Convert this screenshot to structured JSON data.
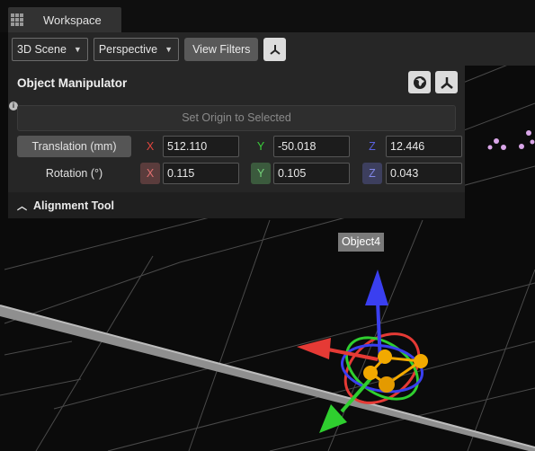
{
  "tabs": [
    {
      "label": "Workspace"
    }
  ],
  "toolbar": {
    "scene_dropdown": "3D Scene",
    "projection_dropdown": "Perspective",
    "view_filters_label": "View Filters",
    "axes_icon": "axes-gizmo-icon"
  },
  "panel": {
    "title": "Object Manipulator",
    "icons": [
      "globe-icon",
      "axes-gizmo-icon"
    ],
    "info_icon": "i",
    "set_origin_label": "Set Origin to Selected",
    "translation": {
      "label": "Translation (mm)",
      "x_axis": "X",
      "y_axis": "Y",
      "z_axis": "Z",
      "x": "512.110",
      "y": "-50.018",
      "z": "12.446"
    },
    "rotation": {
      "label": "Rotation (°)",
      "x_axis": "X",
      "y_axis": "Y",
      "z_axis": "Z",
      "x": "0.115",
      "y": "0.105",
      "z": "0.043"
    },
    "alignment_label": "Alignment Tool"
  },
  "viewport": {
    "object_label": "Object4",
    "colors": {
      "x_axis": "#e53a35",
      "y_axis": "#2fcf2f",
      "z_axis": "#3a3ff0",
      "joint": "#f2a900",
      "point": "#d9a6e8"
    }
  }
}
